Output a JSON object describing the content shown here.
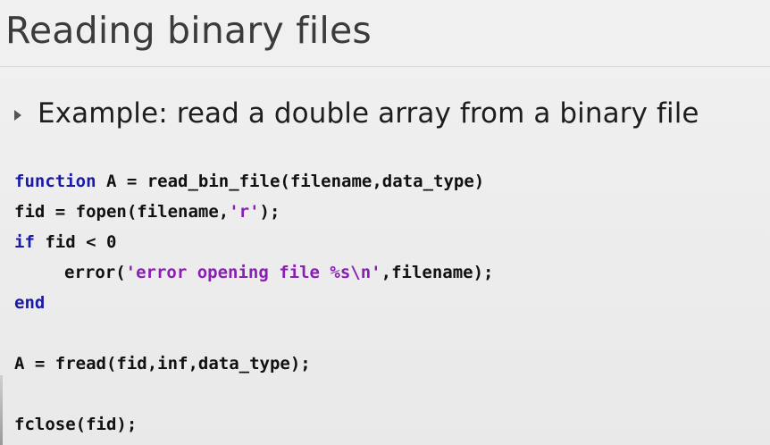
{
  "slide": {
    "title": "Reading binary files",
    "bullet": "Example: read a double array from a binary file",
    "bullet_icon": "triangle-bullet-icon"
  },
  "code": {
    "line1": {
      "keyword": "function",
      "rest": " A = read_bin_file(filename,data_type)"
    },
    "line2": {
      "pre": "fid = fopen(filename,",
      "string": "'r'",
      "post": ");"
    },
    "line3": {
      "keyword": "if",
      "rest": " fid < 0"
    },
    "line4": {
      "pre": "error(",
      "string": "'error opening file %s\\n'",
      "post": ",filename);"
    },
    "line5": {
      "keyword": "end"
    },
    "line6": {
      "text": "A = fread(fid,inf,data_type);"
    },
    "line7": {
      "text": "fclose(fid);"
    }
  },
  "colors": {
    "keyword": "#1a1aa8",
    "string": "#8a1fb4",
    "code_text": "#111111",
    "title_text": "#3b3b3b"
  }
}
